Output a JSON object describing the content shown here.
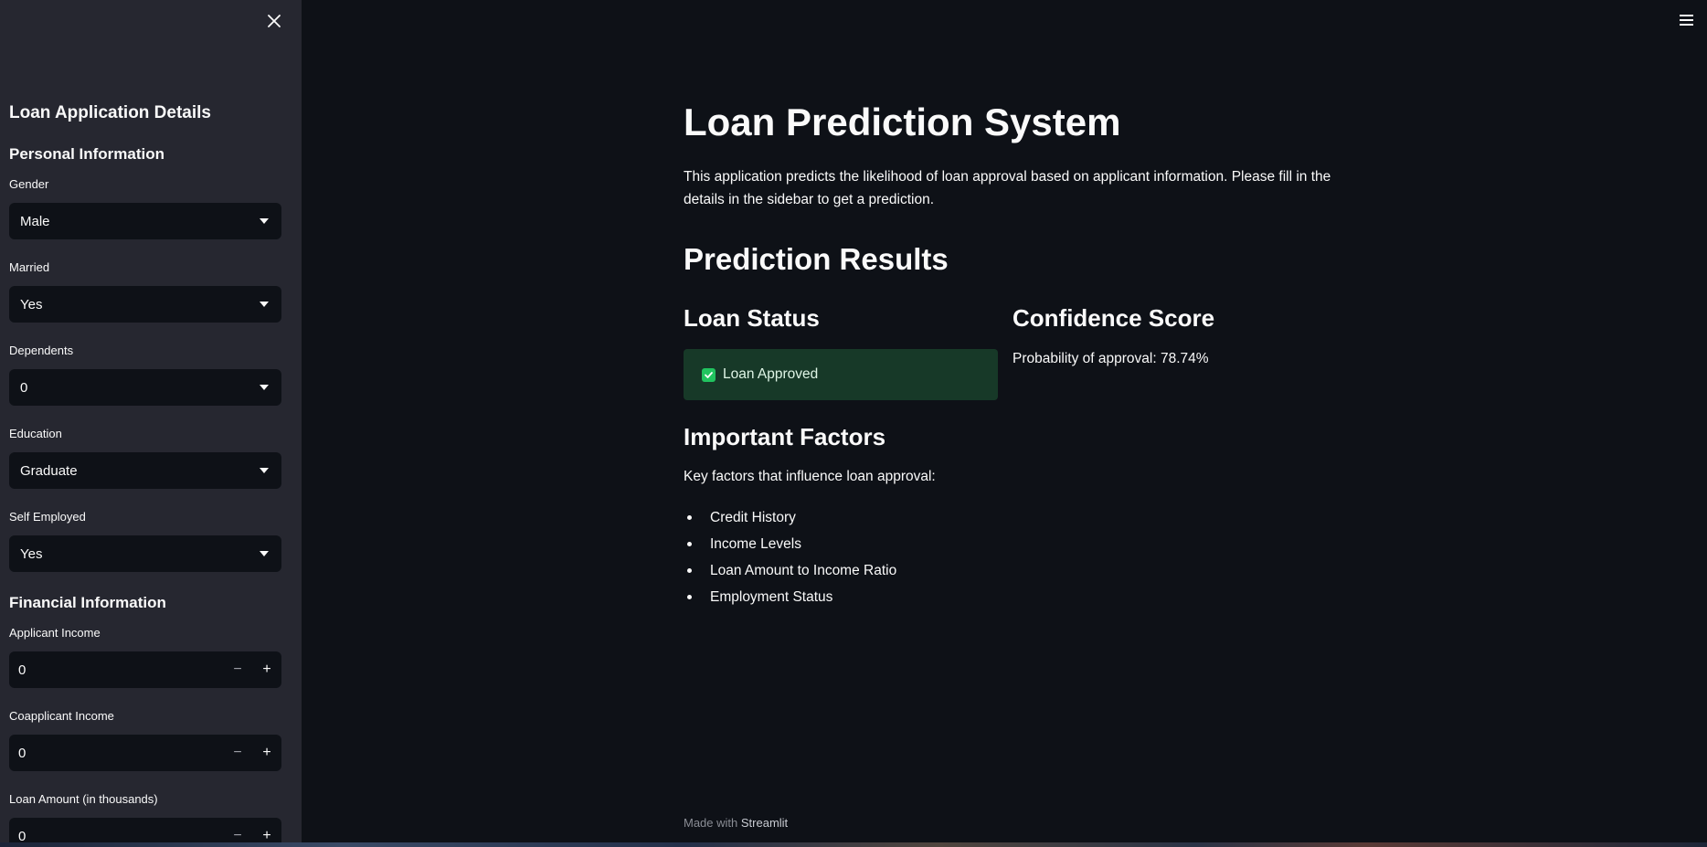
{
  "sidebar": {
    "title": "Loan Application Details",
    "personal_heading": "Personal Information",
    "financial_heading": "Financial Information",
    "fields": {
      "gender": {
        "label": "Gender",
        "value": "Male"
      },
      "married": {
        "label": "Married",
        "value": "Yes"
      },
      "dependents": {
        "label": "Dependents",
        "value": "0"
      },
      "education": {
        "label": "Education",
        "value": "Graduate"
      },
      "self_employed": {
        "label": "Self Employed",
        "value": "Yes"
      },
      "applicant_income": {
        "label": "Applicant Income",
        "value": "0"
      },
      "coapplicant_income": {
        "label": "Coapplicant Income",
        "value": "0"
      },
      "loan_amount": {
        "label": "Loan Amount (in thousands)",
        "value": "0"
      }
    }
  },
  "main": {
    "title": "Loan Prediction System",
    "intro": "This application predicts the likelihood of loan approval based on applicant information. Please fill in the details in the sidebar to get a prediction.",
    "results_heading": "Prediction Results",
    "loan_status_heading": "Loan Status",
    "loan_status_message": "Loan Approved",
    "confidence_heading": "Confidence Score",
    "probability_text": "Probability of approval: 78.74%",
    "factors_heading": "Important Factors",
    "factors_intro": "Key factors that influence loan approval:",
    "factors": [
      "Credit History",
      "Income Levels",
      "Loan Amount to Income Ratio",
      "Employment Status"
    ]
  },
  "footer": {
    "made_with": "Made with",
    "brand": "Streamlit"
  },
  "colors": {
    "background": "#0e1117",
    "sidebar": "#262730",
    "success_bg": "#173928",
    "success_icon": "#21c35f"
  },
  "icons": {
    "close": "close-icon",
    "menu": "hamburger-menu-icon",
    "check": "check-icon",
    "caret": "chevron-down-icon"
  }
}
